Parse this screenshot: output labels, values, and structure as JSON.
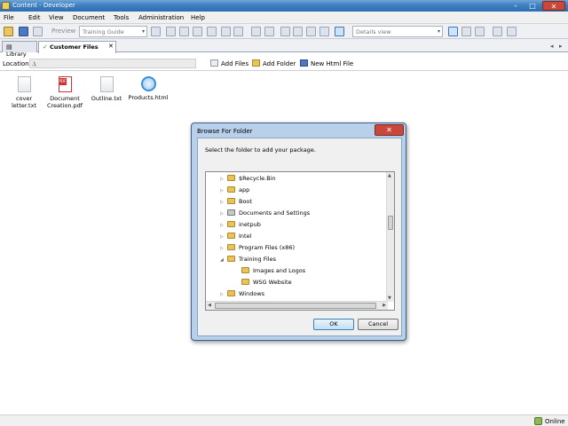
{
  "window": {
    "title": "Content - Developer",
    "min": "–",
    "max": "□",
    "close": "✕"
  },
  "menu": [
    "File",
    "Edit",
    "View",
    "Document",
    "Tools",
    "Administration",
    "Help"
  ],
  "toolbar": {
    "preview_label": "Preview",
    "template_combo": "Training Guide",
    "view_combo": "Details view",
    "dropdown_arrow": "▾"
  },
  "tabs": [
    {
      "label": "Library",
      "icon": "library-icon"
    },
    {
      "label": "Customer Files",
      "icon": "checkmark-icon",
      "close": "✕"
    }
  ],
  "tab_nav": {
    "left": "◂",
    "right": "▸"
  },
  "location": {
    "label": "Location:",
    "value": ".\\",
    "add_files": "Add Files",
    "add_folder": "Add Folder",
    "new_html": "New Html File"
  },
  "files": [
    {
      "name": "cover letter.txt",
      "icon": "text-file-icon"
    },
    {
      "name": "Document Creation.pdf",
      "icon": "pdf-file-icon"
    },
    {
      "name": "Outline.txt",
      "icon": "text-file-icon"
    },
    {
      "name": "Products.html",
      "icon": "html-file-icon"
    }
  ],
  "dialog": {
    "title": "Browse For Folder",
    "close": "✕",
    "prompt": "Select the folder to add your package.",
    "tree": [
      {
        "label": "$Recycle.Bin",
        "expander": "▷",
        "indent": 0
      },
      {
        "label": "app",
        "expander": "▷",
        "indent": 0
      },
      {
        "label": "Boot",
        "expander": "▷",
        "indent": 0
      },
      {
        "label": "Documents and Settings",
        "expander": "▷",
        "indent": 0,
        "locked": true
      },
      {
        "label": "inetpub",
        "expander": "▷",
        "indent": 0
      },
      {
        "label": "Intel",
        "expander": "▷",
        "indent": 0
      },
      {
        "label": "Program Files (x86)",
        "expander": "▷",
        "indent": 0
      },
      {
        "label": "Training Files",
        "expander": "◢",
        "indent": 0
      },
      {
        "label": "Images and Logos",
        "expander": "",
        "indent": 1
      },
      {
        "label": "WSG Website",
        "expander": "",
        "indent": 1
      },
      {
        "label": "Windows",
        "expander": "▷",
        "indent": 0
      }
    ],
    "scroll": {
      "up": "▲",
      "down": "▼",
      "left": "◀",
      "right": "▶"
    },
    "ok": "OK",
    "cancel": "Cancel"
  },
  "status": {
    "connection": "Online"
  }
}
